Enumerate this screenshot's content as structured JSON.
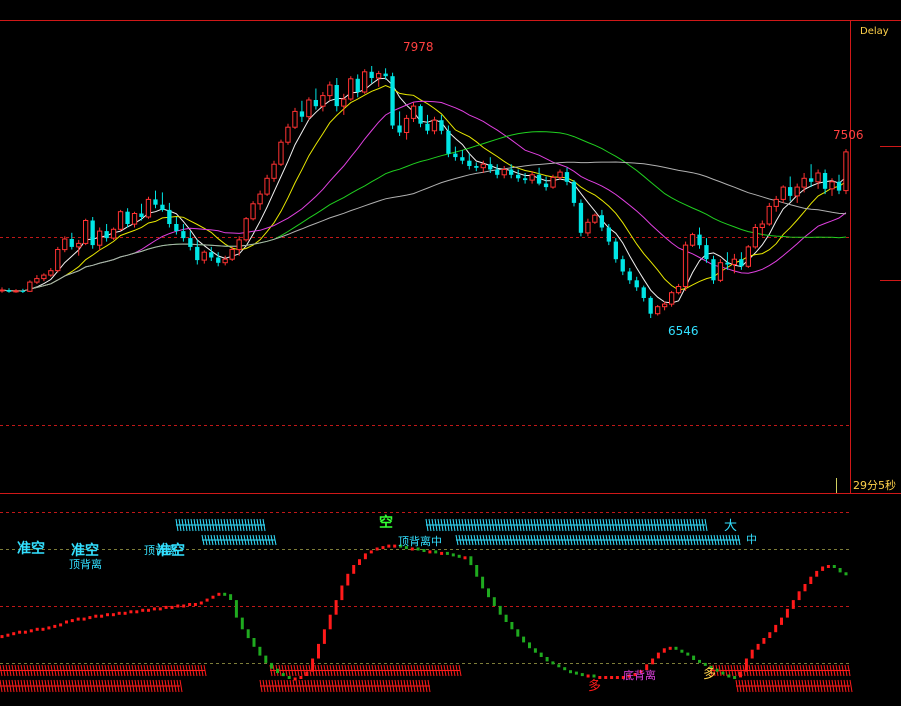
{
  "colors": {
    "up": "#ff3232",
    "down": "#00e5e5",
    "frame": "#d01818",
    "ma5": "#f2f2f2",
    "ma10": "#e8e800",
    "ma20": "#e040e0",
    "ma40": "#20d020",
    "ma60": "#b0b0b0",
    "label_cyan": "#33e0ff",
    "label_green": "#33ff33",
    "label_purple": "#e040e0",
    "label_yellow": "#ffd24a",
    "indicator_up": "#ff1a1a",
    "indicator_down": "#1faa1f"
  },
  "status": {
    "delay": "Delay",
    "timeframe": "29分5秒"
  },
  "chart_data": [
    {
      "type": "candlestick",
      "price_labels": [
        {
          "text": "7978",
          "value": 7978
        },
        {
          "text": "7506",
          "value": 7506
        },
        {
          "text": "6546",
          "value": 6546
        }
      ],
      "candles": [
        [
          6700,
          6720,
          6690,
          6705
        ],
        [
          6705,
          6715,
          6690,
          6695
        ],
        [
          6695,
          6710,
          6690,
          6700
        ],
        [
          6700,
          6712,
          6688,
          6698
        ],
        [
          6698,
          6760,
          6695,
          6750
        ],
        [
          6750,
          6790,
          6740,
          6770
        ],
        [
          6770,
          6800,
          6755,
          6790
        ],
        [
          6790,
          6830,
          6780,
          6815
        ],
        [
          6815,
          6950,
          6805,
          6935
        ],
        [
          6935,
          7010,
          6920,
          6995
        ],
        [
          6995,
          7030,
          6935,
          6950
        ],
        [
          6950,
          6990,
          6900,
          6970
        ],
        [
          6970,
          7110,
          6960,
          7100
        ],
        [
          7100,
          7120,
          6940,
          6960
        ],
        [
          6960,
          7060,
          6930,
          7040
        ],
        [
          7040,
          7080,
          6980,
          7000
        ],
        [
          7000,
          7060,
          6990,
          7050
        ],
        [
          7050,
          7160,
          7040,
          7150
        ],
        [
          7150,
          7170,
          7060,
          7080
        ],
        [
          7080,
          7150,
          7060,
          7140
        ],
        [
          7140,
          7195,
          7100,
          7120
        ],
        [
          7120,
          7235,
          7110,
          7220
        ],
        [
          7220,
          7270,
          7170,
          7190
        ],
        [
          7190,
          7260,
          7150,
          7160
        ],
        [
          7160,
          7200,
          7060,
          7080
        ],
        [
          7080,
          7120,
          7020,
          7040
        ],
        [
          7040,
          7080,
          6980,
          7000
        ],
        [
          7000,
          7040,
          6930,
          6950
        ],
        [
          6950,
          6990,
          6850,
          6875
        ],
        [
          6875,
          6930,
          6855,
          6920
        ],
        [
          6920,
          6950,
          6870,
          6890
        ],
        [
          6890,
          6920,
          6840,
          6860
        ],
        [
          6860,
          6900,
          6845,
          6880
        ],
        [
          6880,
          6950,
          6870,
          6935
        ],
        [
          6935,
          7010,
          6900,
          6990
        ],
        [
          6990,
          7120,
          6980,
          7110
        ],
        [
          7110,
          7210,
          7100,
          7195
        ],
        [
          7195,
          7270,
          7160,
          7250
        ],
        [
          7250,
          7360,
          7240,
          7340
        ],
        [
          7340,
          7440,
          7320,
          7420
        ],
        [
          7420,
          7560,
          7410,
          7545
        ],
        [
          7545,
          7650,
          7530,
          7630
        ],
        [
          7630,
          7740,
          7620,
          7720
        ],
        [
          7720,
          7780,
          7660,
          7690
        ],
        [
          7690,
          7800,
          7670,
          7785
        ],
        [
          7785,
          7850,
          7730,
          7750
        ],
        [
          7750,
          7830,
          7720,
          7810
        ],
        [
          7810,
          7890,
          7780,
          7870
        ],
        [
          7870,
          7910,
          7720,
          7750
        ],
        [
          7750,
          7820,
          7700,
          7790
        ],
        [
          7790,
          7920,
          7780,
          7905
        ],
        [
          7905,
          7930,
          7800,
          7830
        ],
        [
          7830,
          7960,
          7820,
          7945
        ],
        [
          7945,
          7978,
          7880,
          7910
        ],
        [
          7910,
          7950,
          7860,
          7935
        ],
        [
          7935,
          7965,
          7900,
          7920
        ],
        [
          7920,
          7940,
          7620,
          7640
        ],
        [
          7640,
          7720,
          7580,
          7600
        ],
        [
          7600,
          7700,
          7560,
          7680
        ],
        [
          7680,
          7770,
          7660,
          7750
        ],
        [
          7750,
          7760,
          7630,
          7650
        ],
        [
          7650,
          7700,
          7590,
          7610
        ],
        [
          7610,
          7690,
          7590,
          7670
        ],
        [
          7670,
          7700,
          7590,
          7610
        ],
        [
          7610,
          7640,
          7460,
          7480
        ],
        [
          7480,
          7520,
          7440,
          7460
        ],
        [
          7460,
          7500,
          7420,
          7440
        ],
        [
          7440,
          7480,
          7390,
          7410
        ],
        [
          7410,
          7430,
          7380,
          7400
        ],
        [
          7400,
          7440,
          7370,
          7420
        ],
        [
          7420,
          7460,
          7370,
          7390
        ],
        [
          7390,
          7420,
          7340,
          7360
        ],
        [
          7360,
          7410,
          7340,
          7390
        ],
        [
          7390,
          7420,
          7340,
          7360
        ],
        [
          7360,
          7390,
          7320,
          7340
        ],
        [
          7340,
          7370,
          7310,
          7330
        ],
        [
          7330,
          7380,
          7310,
          7360
        ],
        [
          7360,
          7400,
          7300,
          7310
        ],
        [
          7310,
          7350,
          7270,
          7290
        ],
        [
          7290,
          7360,
          7280,
          7345
        ],
        [
          7345,
          7390,
          7330,
          7375
        ],
        [
          7375,
          7400,
          7300,
          7320
        ],
        [
          7320,
          7330,
          7180,
          7200
        ],
        [
          7200,
          7220,
          7010,
          7030
        ],
        [
          7030,
          7110,
          7010,
          7090
        ],
        [
          7090,
          7140,
          7080,
          7130
        ],
        [
          7130,
          7160,
          7040,
          7060
        ],
        [
          7060,
          7080,
          6960,
          6980
        ],
        [
          6980,
          7000,
          6860,
          6880
        ],
        [
          6880,
          6900,
          6790,
          6810
        ],
        [
          6810,
          6830,
          6740,
          6760
        ],
        [
          6760,
          6780,
          6700,
          6720
        ],
        [
          6720,
          6730,
          6640,
          6660
        ],
        [
          6660,
          6670,
          6546,
          6570
        ],
        [
          6570,
          6620,
          6560,
          6610
        ],
        [
          6610,
          6640,
          6590,
          6625
        ],
        [
          6625,
          6700,
          6610,
          6690
        ],
        [
          6690,
          6740,
          6680,
          6725
        ],
        [
          6725,
          6980,
          6700,
          6960
        ],
        [
          6960,
          7030,
          6950,
          7020
        ],
        [
          7020,
          7060,
          6940,
          6960
        ],
        [
          6960,
          7000,
          6860,
          6880
        ],
        [
          6880,
          6900,
          6740,
          6760
        ],
        [
          6760,
          6880,
          6750,
          6860
        ],
        [
          6860,
          6920,
          6820,
          6850
        ],
        [
          6850,
          6910,
          6800,
          6880
        ],
        [
          6880,
          6920,
          6820,
          6840
        ],
        [
          6840,
          6960,
          6830,
          6950
        ],
        [
          6950,
          7080,
          6940,
          7060
        ],
        [
          7060,
          7100,
          7010,
          7080
        ],
        [
          7080,
          7200,
          7070,
          7180
        ],
        [
          7180,
          7240,
          7150,
          7220
        ],
        [
          7220,
          7300,
          7200,
          7290
        ],
        [
          7290,
          7350,
          7210,
          7240
        ],
        [
          7240,
          7310,
          7200,
          7290
        ],
        [
          7290,
          7370,
          7260,
          7340
        ],
        [
          7340,
          7420,
          7290,
          7320
        ],
        [
          7320,
          7390,
          7280,
          7370
        ],
        [
          7370,
          7390,
          7250,
          7280
        ],
        [
          7280,
          7340,
          7240,
          7320
        ],
        [
          7320,
          7360,
          7250,
          7270
        ],
        [
          7270,
          7506,
          7250,
          7490
        ]
      ]
    },
    {
      "type": "line",
      "name_visible": false,
      "x_range": [
        0,
        140
      ],
      "y_range": [
        0,
        100
      ],
      "values": [
        28,
        29,
        30,
        31,
        31,
        32,
        33,
        33,
        34,
        35,
        36,
        38,
        39,
        40,
        40,
        41,
        42,
        42,
        43,
        43,
        44,
        44,
        45,
        45,
        46,
        46,
        47,
        47,
        48,
        48,
        49,
        49,
        50,
        50,
        51,
        53,
        55,
        57,
        56,
        52,
        40,
        32,
        26,
        20,
        14,
        9,
        5,
        2,
        0,
        -1,
        -1,
        0,
        3,
        12,
        22,
        32,
        42,
        52,
        62,
        70,
        76,
        80,
        84,
        86,
        88,
        89,
        90,
        90,
        89,
        88,
        88,
        87,
        86,
        86,
        85,
        85,
        84,
        83,
        82,
        82,
        76,
        68,
        60,
        54,
        48,
        42,
        37,
        32,
        27,
        23,
        19,
        16,
        13,
        10,
        8,
        6,
        4,
        3,
        2,
        1,
        1,
        0,
        0,
        0,
        0,
        0,
        0,
        1,
        2,
        4,
        8,
        12,
        16,
        19,
        20,
        18,
        16,
        14,
        11,
        9,
        7,
        5,
        3,
        1,
        0,
        -1,
        3,
        12,
        18,
        22,
        26,
        30,
        35,
        40,
        46,
        52,
        58,
        63,
        68,
        72,
        75,
        76,
        74,
        71,
        69
      ],
      "annotations": [
        {
          "text": "准空",
          "color": "label_cyan"
        },
        {
          "text": "准空",
          "color": "label_cyan"
        },
        {
          "text": "顶背离",
          "color": "label_cyan"
        },
        {
          "text": "顶背离",
          "color": "label_cyan"
        },
        {
          "text": "准空",
          "color": "label_cyan"
        },
        {
          "text": "空",
          "color": "label_green"
        },
        {
          "text": "顶背离中",
          "color": "label_cyan"
        },
        {
          "text": "中",
          "color": "label_cyan"
        },
        {
          "text": "中",
          "color": "label_cyan"
        },
        {
          "text": "大",
          "color": "label_cyan"
        },
        {
          "text": "底背离",
          "color": "label_purple"
        },
        {
          "text": "多",
          "color": "indicator_up"
        },
        {
          "text": "多",
          "color": "label_yellow"
        }
      ]
    }
  ]
}
